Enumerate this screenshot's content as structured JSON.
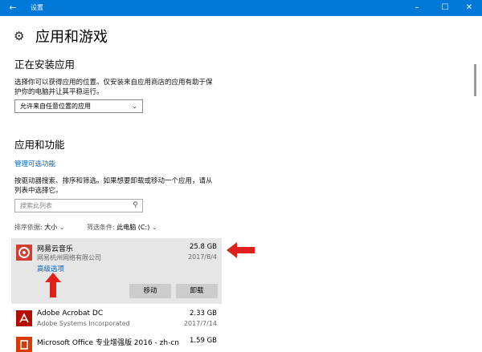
{
  "window": {
    "back_icon": "back-arrow-icon",
    "title": "设置",
    "minimize_icon": "minimize-icon",
    "maximize_icon": "maximize-icon",
    "close_icon": "close-icon"
  },
  "header": {
    "icon": "gear-icon",
    "title": "应用和游戏"
  },
  "install_section": {
    "heading": "正在安装应用",
    "desc_line1": "选择你可以获得应用的位置。仅安装来自应用商店的应用有助于保",
    "desc_line2": "护你的电脑并让其平稳运行。",
    "dropdown_value": "允许来自任意位置的应用"
  },
  "apps_section": {
    "heading": "应用和功能",
    "manage_link": "管理可选功能",
    "desc_line1": "按驱动器搜索、排序和筛选。如果想要卸载或移动一个应用，请从",
    "desc_line2": "列表中选择它。",
    "search_placeholder": "搜索此列表",
    "sort_label": "排序依据:",
    "sort_value": "大小",
    "filter_label": "筛选条件:",
    "filter_value": "此电脑 (C:)"
  },
  "apps": [
    {
      "name": "网易云音乐",
      "publisher": "网易杭州网络有限公司",
      "size": "25.8 GB",
      "date": "2017/8/4",
      "advanced_link": "高级选项",
      "move_button": "移动",
      "uninstall_button": "卸载",
      "icon": "netease-music-icon",
      "icon_color": "#d43c33"
    },
    {
      "name": "Adobe Acrobat DC",
      "publisher": "Adobe Systems Incorporated",
      "size": "2.33 GB",
      "date": "2017/7/14",
      "icon": "adobe-acrobat-icon",
      "icon_color": "#b30b00"
    },
    {
      "name": "Microsoft Office 专业增强版 2016  - zh-cn",
      "publisher": "",
      "size": "1.59 GB",
      "date": "",
      "icon": "office-icon",
      "icon_color": "#d83b01"
    }
  ],
  "colors": {
    "accent": "#0078d7",
    "link": "#0067c0",
    "annotation": "#e0201b"
  }
}
